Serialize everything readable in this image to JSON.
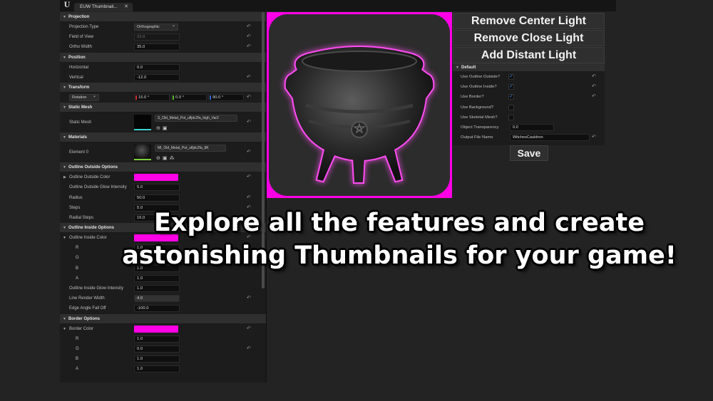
{
  "window": {
    "logo_text": "U",
    "tab_label": "EUW Thumbnail...",
    "tab_close": "✕"
  },
  "left_panel": {
    "projection": {
      "header": "Projection",
      "projection_type_label": "Projection Type",
      "projection_type_value": "Orthographic",
      "fov_label": "Field of View",
      "fov_value": "22.0",
      "ortho_width_label": "Ortho Width",
      "ortho_width_value": "35.0"
    },
    "position": {
      "header": "Position",
      "horizontal_label": "Horizontal",
      "horizontal_value": "0.0",
      "vertical_label": "Vertical",
      "vertical_value": "-12.0"
    },
    "transform": {
      "header": "Transform",
      "mode_value": "Rotation",
      "x": "15.0 °",
      "y": "0.0 °",
      "z": "90.0 °"
    },
    "static_mesh": {
      "header": "Static Mesh",
      "label": "Static Mesh",
      "asset": "S_Old_Metal_Pot_ufljdc2fa_high_Var2"
    },
    "materials": {
      "header": "Materials",
      "label": "Element 0",
      "asset": "MI_Old_Metal_Pot_ufljdc2fa_8K"
    },
    "outline_outside": {
      "header": "Outline Outside Options",
      "color_label": "Outline Outside Color",
      "glow_label": "Outline Outside Glow Intensity",
      "glow_value": "5.0",
      "radius_label": "Radius",
      "radius_value": "50.0",
      "steps_label": "Steps",
      "steps_value": "5.0",
      "radial_steps_label": "Radial Steps",
      "radial_steps_value": "16.0"
    },
    "outline_inside": {
      "header": "Outline Inside Options",
      "color_label": "Outline Inside Color",
      "r_label": "R",
      "r_value": "1.0",
      "g_label": "G",
      "g_value": "0.0",
      "b_label": "B",
      "b_value": "1.0",
      "a_label": "A",
      "a_value": "1.0",
      "glow_label": "Outline Inside Glow Intensity",
      "glow_value": "1.0",
      "line_width_label": "Line Render Width",
      "line_width_value": "4.0",
      "edge_falloff_label": "Edge Angle Fall Off",
      "edge_falloff_value": "-100.0"
    },
    "border": {
      "header": "Border Options",
      "color_label": "Border Color",
      "r_label": "R",
      "r_value": "1.0",
      "g_label": "G",
      "g_value": "0.0",
      "b_label": "B",
      "b_value": "1.0",
      "a_label": "A",
      "a_value": "1.0"
    }
  },
  "buttons": {
    "remove_center_light": "Remove Center Light",
    "remove_close_light": "Remove Close Light",
    "add_distant_light": "Add Distant Light",
    "save": "Save"
  },
  "right_panel": {
    "header": "Default",
    "use_outline_outside_label": "Use Outline Outside?",
    "use_outline_inside_label": "Use Outline Inside?",
    "use_border_label": "Use Border?",
    "use_background_label": "Use Background?",
    "use_skeletal_mesh_label": "Use Skeletal Mesh?",
    "transparency_label": "Object Transparency",
    "transparency_value": "0.0",
    "output_file_label": "Output File Name",
    "output_file_value": "WitchesCauldron",
    "checks": {
      "outline_outside": true,
      "outline_inside": true,
      "border": true,
      "background": false,
      "skeletal_mesh": false
    }
  },
  "caption": {
    "line1": "Explore all the features and create",
    "line2": "astonishing Thumbnails for your game!"
  },
  "colors": {
    "accent_magenta": "#ff00e6",
    "panel_bg": "#1c1c1c",
    "page_bg": "#232323"
  },
  "icons": {
    "reset": "reset-arrow-icon",
    "expand": "triangle-down-icon",
    "browse": "browse-icon",
    "use_selected": "use-selected-icon"
  }
}
